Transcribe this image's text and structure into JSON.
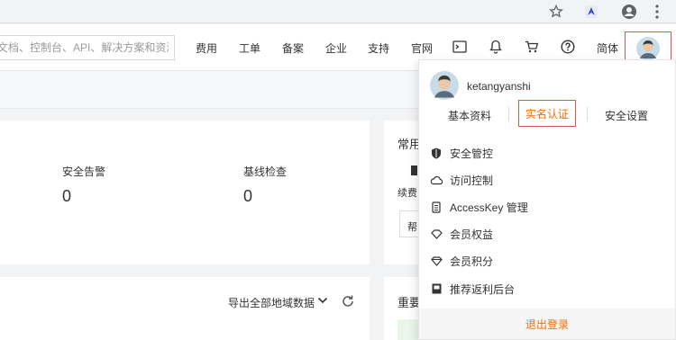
{
  "topnav": {
    "search_placeholder": "文档、控制台、API、解决方案和资源",
    "links": [
      "费用",
      "工单",
      "备案",
      "企业",
      "支持",
      "官网"
    ],
    "lang": "简体"
  },
  "overview": {
    "stats": [
      {
        "label": "安全告警",
        "value": "0"
      },
      {
        "label": "基线检查",
        "value": "0"
      }
    ],
    "common_title": "常用",
    "renew_label": "续费",
    "help_label": "帮",
    "export_label": "导出全部地域数据",
    "important_title": "重要"
  },
  "dropdown": {
    "username": "ketangyanshi",
    "tabs": [
      "基本资料",
      "实名认证",
      "安全设置"
    ],
    "items": [
      {
        "icon": "shield-icon",
        "label": "安全管控"
      },
      {
        "icon": "cloud-icon",
        "label": "访问控制"
      },
      {
        "icon": "key-icon",
        "label": "AccessKey 管理"
      },
      {
        "icon": "diamond-icon",
        "label": "会员权益"
      },
      {
        "icon": "gem-icon",
        "label": "会员积分"
      },
      {
        "icon": "referral-icon",
        "label": "推荐返利后台"
      }
    ],
    "logout": "退出登录"
  },
  "colors": {
    "accent": "#ff6a00",
    "highlight_border": "#d9534f"
  }
}
